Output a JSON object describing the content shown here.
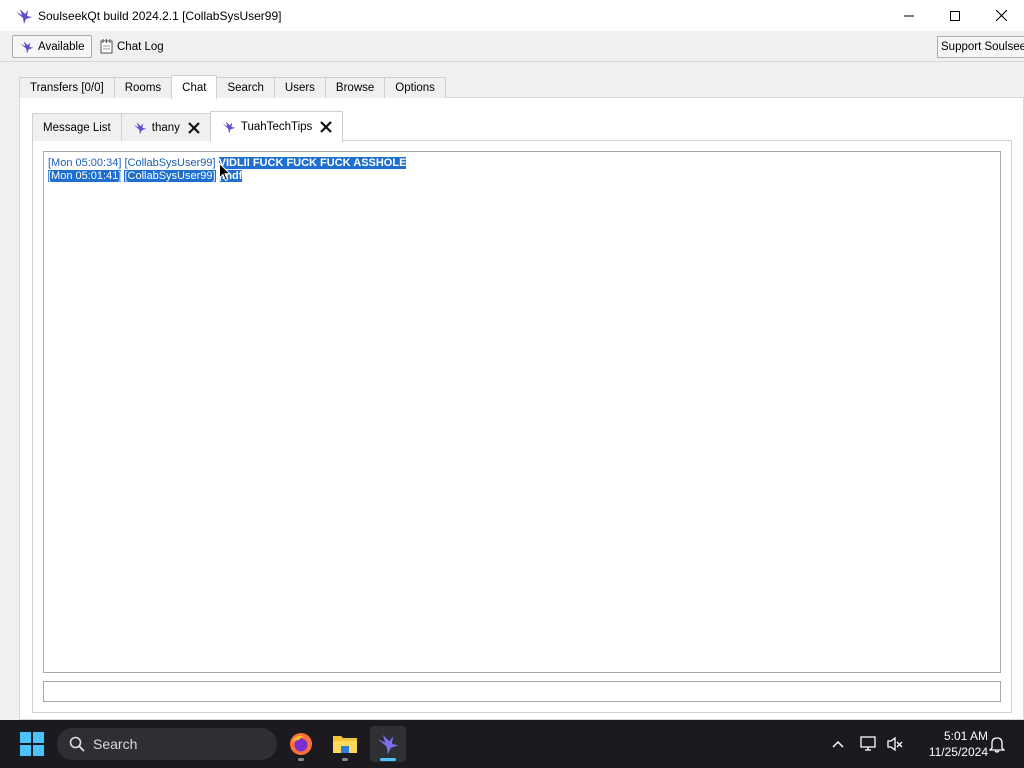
{
  "window": {
    "title": "SoulseekQt build 2024.2.1 [CollabSysUser99]"
  },
  "toolbar": {
    "status_label": "Available",
    "chatlog_label": "Chat Log",
    "support_label": "Support Soulseek"
  },
  "main_tabs": [
    {
      "label": "Transfers [0/0]",
      "active": false
    },
    {
      "label": "Rooms",
      "active": false
    },
    {
      "label": "Chat",
      "active": true
    },
    {
      "label": "Search",
      "active": false
    },
    {
      "label": "Users",
      "active": false
    },
    {
      "label": "Browse",
      "active": false
    },
    {
      "label": "Options",
      "active": false
    }
  ],
  "chat_tabs": [
    {
      "label": "Message List",
      "active": false
    },
    {
      "label": "thany",
      "active": false
    },
    {
      "label": "TuahTechTips",
      "active": true
    }
  ],
  "messages": [
    {
      "timestamp": "[Mon 05:00:34]",
      "user": "[CollabSysUser99]",
      "text": "VIDLII FUCK FUCK FUCK ASSHOLE"
    },
    {
      "timestamp": "[Mon 05:01:41]",
      "user": "[CollabSysUser99]",
      "text": "jfhdf"
    }
  ],
  "chat_input": {
    "value": ""
  },
  "taskbar": {
    "search_placeholder": "Search",
    "time": "5:01 AM",
    "date": "11/25/2024"
  },
  "colors": {
    "accent": "#1e6fd0",
    "link_blue": "#1a5fb4",
    "taskbar_bg": "#1b1b1f",
    "active_indicator": "#4cc2ff"
  }
}
